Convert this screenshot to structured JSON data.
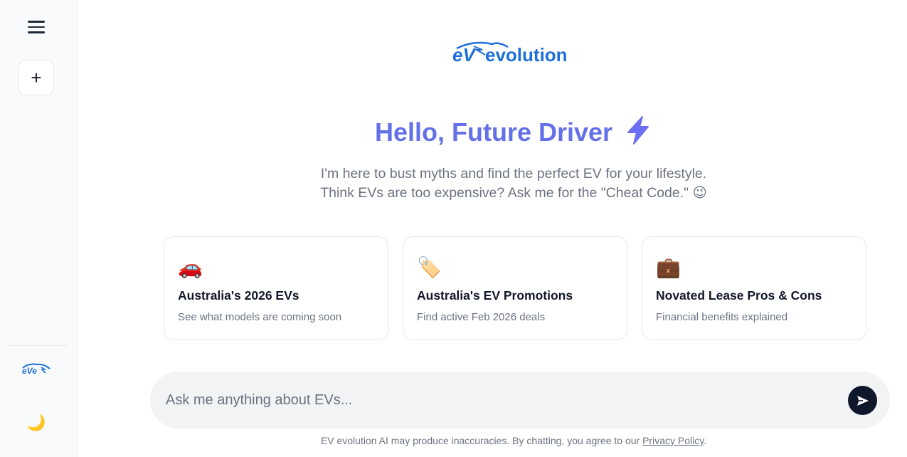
{
  "sidebar": {
    "menu_icon": "hamburger-icon",
    "new_chat_label": "+",
    "logo_alt": "EV evolution logo",
    "theme_toggle": "🌙"
  },
  "brand": {
    "logo_text": "evolution",
    "logo_mark": "eV"
  },
  "hero": {
    "greeting": "Hello, Future Driver",
    "intro_line1": "I'm here to bust myths and find the perfect EV for your lifestyle.",
    "intro_line2": "Think EVs are too expensive? Ask me for the \"Cheat Code.\" 😉"
  },
  "cards": [
    {
      "emoji": "🚗",
      "title": "Australia's 2026 EVs",
      "subtitle": "See what models are coming soon"
    },
    {
      "emoji": "🏷️",
      "title": "Australia's EV Promotions",
      "subtitle": "Find active Feb 2026 deals"
    },
    {
      "emoji": "💼",
      "title": "Novated Lease Pros & Cons",
      "subtitle": "Financial benefits explained"
    }
  ],
  "composer": {
    "placeholder": "Ask me anything about EVs...",
    "value": ""
  },
  "disclaimer": {
    "text": "EV evolution AI may produce inaccuracies. By chatting, you agree to our ",
    "link": "Privacy Policy",
    "end": "."
  },
  "colors": {
    "accent": "#6366f1",
    "brand_blue": "#1e6fd9",
    "send_bg": "#0f172a"
  }
}
